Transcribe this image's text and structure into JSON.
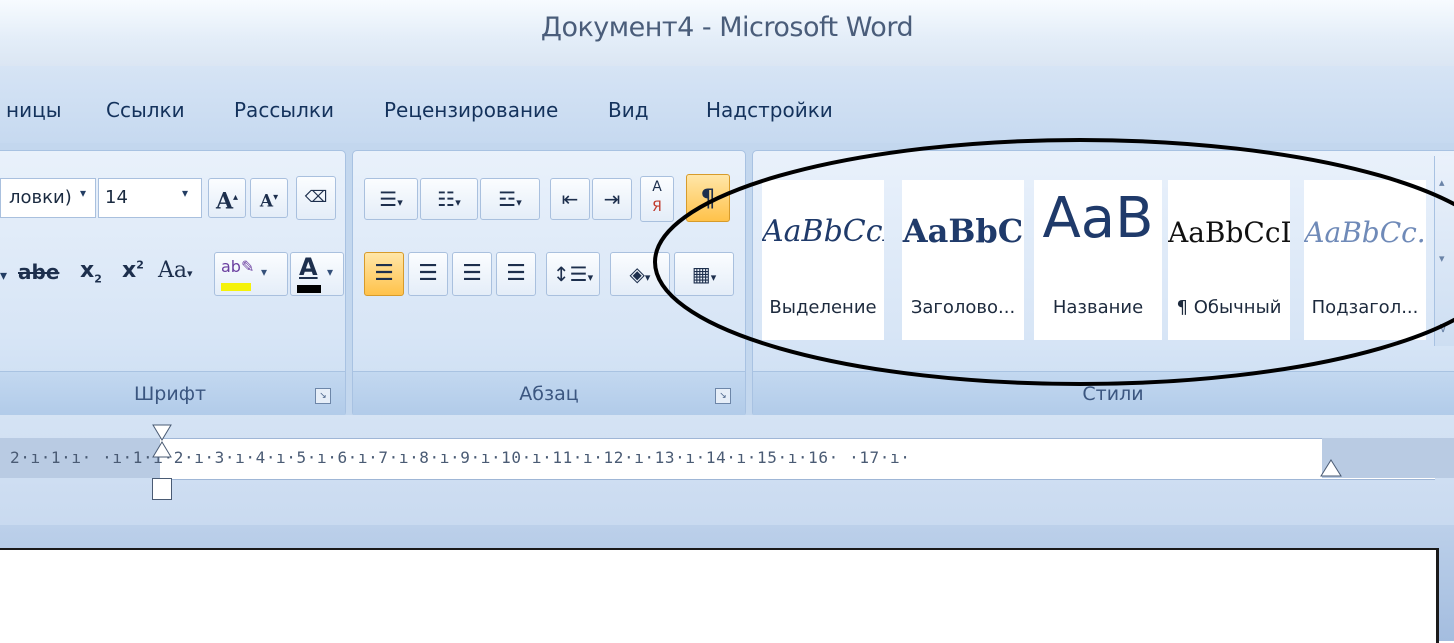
{
  "window": {
    "title": "Документ4 - Microsoft Word"
  },
  "tabs": [
    "ницы",
    "Ссылки",
    "Рассылки",
    "Рецензирование",
    "Вид",
    "Надстройки"
  ],
  "font_group": {
    "font_name": "ловки)",
    "font_size": "14",
    "label": "Шрифт",
    "grow_label": "A",
    "shrink_label": "A",
    "strike_label": "abe",
    "sub_label": "x",
    "sup_label": "x",
    "case_label": "Aa",
    "color_label": "A"
  },
  "paragraph_group": {
    "label": "Абзац"
  },
  "styles_group": {
    "label": "Стили",
    "items": [
      {
        "sample": "AaBbCcI",
        "label": "Выделение"
      },
      {
        "sample": "AaBbC",
        "label": "Заголово..."
      },
      {
        "sample": "AaB",
        "label": "Название"
      },
      {
        "sample": "AaBbCcI",
        "label": "¶ Обычный"
      },
      {
        "sample": "AaBbCc.",
        "label": "Подзагол..."
      }
    ]
  },
  "ruler": {
    "text": "2·ı·1·ı·  ·ı·1·ı·2·ı·3·ı·4·ı·5·ı·6·ı·7·ı·8·ı·9·ı·10·ı·11·ı·12·ı·13·ı·14·ı·15·ı·16·  ·17·ı·"
  }
}
